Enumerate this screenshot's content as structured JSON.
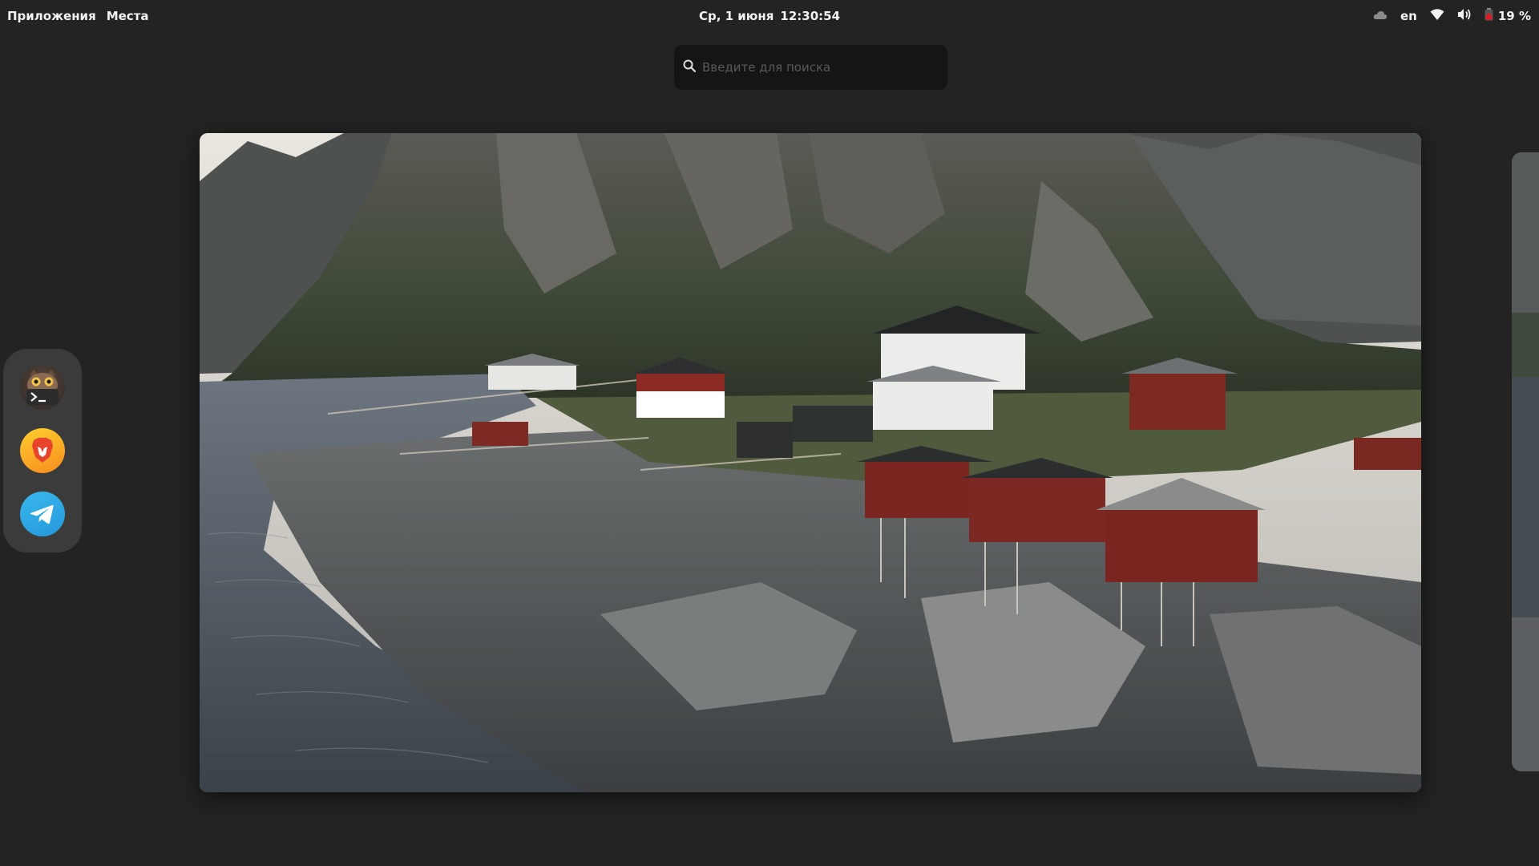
{
  "topbar": {
    "apps_label": "Приложения",
    "places_label": "Места",
    "date": "Ср, 1 июня",
    "time": "12:30:54",
    "lang": "en",
    "battery": "19 %",
    "battery_color": "#e01b24"
  },
  "search": {
    "placeholder": "Введите для поиска"
  },
  "dash": {
    "apps": [
      {
        "name": "Terminal",
        "icon": "terminal-icon"
      },
      {
        "name": "Brave",
        "icon": "brave-lion-icon"
      },
      {
        "name": "Telegram",
        "icon": "telegram-plane-icon"
      }
    ]
  },
  "workspace": {
    "wallpaper": "lofoten-fishing-village-photo"
  }
}
